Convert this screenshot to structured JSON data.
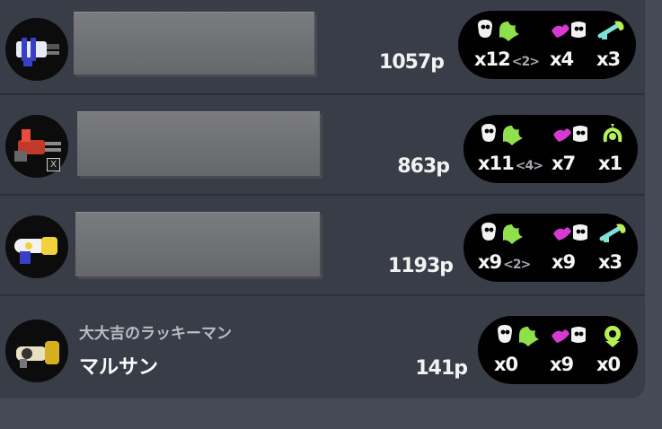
{
  "players": [
    {
      "weapon_icon": "heavy-splatling-icon",
      "name_hidden": true,
      "points": "1057p",
      "kills": "x12",
      "specials_in_kills": "<2>",
      "specials": "x4",
      "special_icon": "ink-storm-icon",
      "special_uses": "x3"
    },
    {
      "weapon_icon": "hydra-splatling-icon",
      "name_hidden": true,
      "badge": "X",
      "points": "863p",
      "kills": "x11",
      "specials_in_kills": "<4>",
      "specials": "x7",
      "special_icon": "bubble-blower-icon",
      "special_uses": "x1"
    },
    {
      "weapon_icon": "splat-dualies-icon",
      "name_hidden": true,
      "points": "1193p",
      "kills": "x9",
      "specials_in_kills": "<2>",
      "specials": "x9",
      "special_icon": "ink-storm-icon",
      "special_uses": "x3"
    },
    {
      "weapon_icon": "explosher-icon",
      "name_hidden": false,
      "title": "大大吉のラッキーマン",
      "name": "マルサン",
      "points": "141p",
      "kills": "x0",
      "specials_in_kills": "",
      "specials": "x9",
      "special_icon": "baller-icon",
      "special_uses": "x0"
    }
  ],
  "colors": {
    "ink_green": "#8fe04a",
    "ink_magenta": "#d63ad0",
    "special_green": "#b6ef5a",
    "panel": "#393d47",
    "background": "#454a55"
  }
}
